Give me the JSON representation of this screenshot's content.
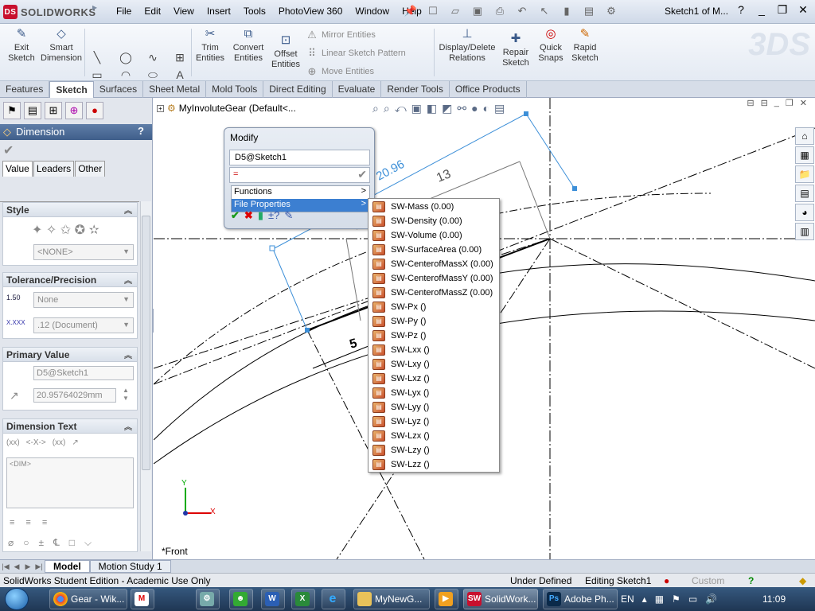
{
  "titlebar": {
    "app_name": "SOLIDWORKS",
    "menus": [
      "File",
      "Edit",
      "View",
      "Insert",
      "Tools",
      "PhotoView 360",
      "Window",
      "Help"
    ],
    "doc_title": "Sketch1 of M...",
    "help_glyph": "?"
  },
  "commands": {
    "exit_sketch": "Exit Sketch",
    "smart_dimension": "Smart Dimension",
    "trim_entities": "Trim Entities",
    "convert_entities": "Convert Entities",
    "offset_entities": "Offset Entities",
    "mirror_entities": "Mirror Entities",
    "linear_sketch_pattern": "Linear Sketch Pattern",
    "move_entities": "Move Entities",
    "display_delete_relations": "Display/Delete Relations",
    "repair_sketch": "Repair Sketch",
    "quick_snaps": "Quick Snaps",
    "rapid_sketch": "Rapid Sketch"
  },
  "tabs": [
    "Features",
    "Sketch",
    "Surfaces",
    "Sheet Metal",
    "Mold Tools",
    "Direct Editing",
    "Evaluate",
    "Render Tools",
    "Office Products"
  ],
  "active_tab": "Sketch",
  "property_manager": {
    "title": "Dimension",
    "help": "?",
    "tabs": [
      "Value",
      "Leaders",
      "Other"
    ],
    "style": {
      "header": "Style",
      "dropdown": "<NONE>"
    },
    "tolerance": {
      "header": "Tolerance/Precision",
      "tol_icon": "1.50",
      "tolerance_type": "None",
      "precision_icon": "X.XXX",
      "precision": ".12 (Document)"
    },
    "primary_value": {
      "header": "Primary Value",
      "name": "D5@Sketch1",
      "value": "20.95764029mm"
    },
    "dimension_text": {
      "header": "Dimension Text",
      "token_1": "(xx)",
      "token_2": "<-X->",
      "token_3": "(xx)",
      "text": "<DIM>"
    }
  },
  "graphics": {
    "tree_item": "MyInvoluteGear  (Default<...",
    "view_label": "*Front",
    "dimensions": {
      "d1": "20.96",
      "d2": "13",
      "d3": "5"
    },
    "triad": {
      "x": "X",
      "y": "Y"
    }
  },
  "modify_dialog": {
    "title": "Modify",
    "name": "D5@Sketch1",
    "expression": "=",
    "menu": [
      {
        "label": "Functions",
        "selected": false
      },
      {
        "label": "File Properties",
        "selected": true
      }
    ]
  },
  "file_properties": [
    "SW-Mass (0.00)",
    "SW-Density (0.00)",
    "SW-Volume (0.00)",
    "SW-SurfaceArea (0.00)",
    "SW-CenterofMassX (0.00)",
    "SW-CenterofMassY (0.00)",
    "SW-CenterofMassZ (0.00)",
    "SW-Px ()",
    "SW-Py ()",
    "SW-Pz ()",
    "SW-Lxx ()",
    "SW-Lxy ()",
    "SW-Lxz ()",
    "SW-Lyx ()",
    "SW-Lyy ()",
    "SW-Lyz ()",
    "SW-Lzx ()",
    "SW-Lzy ()",
    "SW-Lzz ()"
  ],
  "model_tabs": [
    "Model",
    "Motion Study 1"
  ],
  "status": {
    "edition": "SolidWorks Student Edition - Academic Use Only",
    "state": "Under Defined",
    "editing": "Editing Sketch1",
    "units": "Custom",
    "help": "?"
  },
  "taskbar": {
    "items": [
      {
        "label": "Gear - Wik...",
        "icon": "chrome"
      },
      {
        "label": "MyNewG...",
        "icon": "folder"
      },
      {
        "label": "SolidWork...",
        "icon": "solidworks"
      },
      {
        "label": "Adobe Ph...",
        "icon": "photoshop"
      }
    ],
    "quick_launch": [
      {
        "glyph": "M"
      },
      {
        "glyph": "W"
      },
      {
        "glyph": "X"
      }
    ],
    "lang": "EN",
    "clock": "11:09"
  },
  "colors": {
    "accent": "#3c7fd1",
    "dimension_blue": "#3c8fd8",
    "header_blue": "#4f6e98",
    "taskbar": "#2a4768"
  }
}
